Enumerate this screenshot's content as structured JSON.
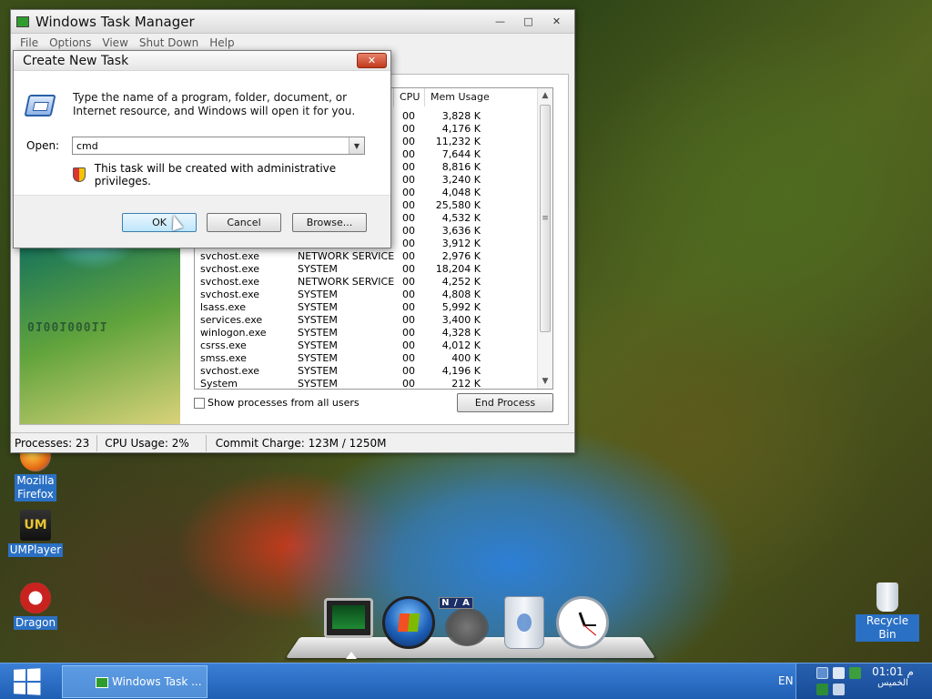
{
  "desktop": {
    "icons": [
      {
        "label_line1": "Mozilla",
        "label_line2": "Firefox"
      },
      {
        "label": "UMPlayer",
        "glyph": "UM"
      },
      {
        "label": "Dragon"
      },
      {
        "label": "Recycle Bin"
      }
    ]
  },
  "task_manager": {
    "title": "Windows Task Manager",
    "controls": {
      "minimize": "—",
      "maximize": "□",
      "close": "✕"
    },
    "menu": [
      "File",
      "Options",
      "View",
      "Shut Down",
      "Help"
    ],
    "columns": {
      "cpu": "CPU",
      "mem": "Mem Usage"
    },
    "processes_top": [
      {
        "cpu": "00",
        "mem": "3,828 K"
      },
      {
        "cpu": "00",
        "mem": "4,176 K"
      },
      {
        "cpu": "00",
        "mem": "11,232 K"
      },
      {
        "cpu": "00",
        "mem": "7,644 K"
      },
      {
        "cpu": "00",
        "mem": "8,816 K"
      },
      {
        "cpu": "00",
        "mem": "3,240 K"
      },
      {
        "cpu": "00",
        "mem": "4,048 K"
      },
      {
        "cpu": "00",
        "mem": "25,580 K"
      },
      {
        "cpu": "00",
        "mem": "4,532 K"
      },
      {
        "cpu": "00",
        "mem": "3,636 K"
      },
      {
        "cpu": "00",
        "mem": "3,912 K"
      }
    ],
    "processes": [
      {
        "name": "svchost.exe",
        "user": "NETWORK SERVICE",
        "cpu": "00",
        "mem": "2,976 K"
      },
      {
        "name": "svchost.exe",
        "user": "SYSTEM",
        "cpu": "00",
        "mem": "18,204 K"
      },
      {
        "name": "svchost.exe",
        "user": "NETWORK SERVICE",
        "cpu": "00",
        "mem": "4,252 K"
      },
      {
        "name": "svchost.exe",
        "user": "SYSTEM",
        "cpu": "00",
        "mem": "4,808 K"
      },
      {
        "name": "lsass.exe",
        "user": "SYSTEM",
        "cpu": "00",
        "mem": "5,992 K"
      },
      {
        "name": "services.exe",
        "user": "SYSTEM",
        "cpu": "00",
        "mem": "3,400 K"
      },
      {
        "name": "winlogon.exe",
        "user": "SYSTEM",
        "cpu": "00",
        "mem": "4,328 K"
      },
      {
        "name": "csrss.exe",
        "user": "SYSTEM",
        "cpu": "00",
        "mem": "4,012 K"
      },
      {
        "name": "smss.exe",
        "user": "SYSTEM",
        "cpu": "00",
        "mem": "400 K"
      },
      {
        "name": "svchost.exe",
        "user": "SYSTEM",
        "cpu": "00",
        "mem": "4,196 K"
      },
      {
        "name": "System",
        "user": "SYSTEM",
        "cpu": "00",
        "mem": "212 K"
      }
    ],
    "show_all_label": "Show processes from all users",
    "end_process_label": "End Process",
    "status": {
      "processes": "Processes: 23",
      "cpu": "CPU Usage: 2%",
      "commit": "Commit Charge: 123M / 1250M"
    }
  },
  "create_task_dialog": {
    "title": "Create New Task",
    "close": "✕",
    "description": "Type the name of a program, folder, document, or Internet resource, and Windows will open it for you.",
    "open_label": "Open:",
    "open_value": "cmd",
    "dropdown_arrow": "▼",
    "admin_note": "This task will be created with administrative privileges.",
    "ok_label": "OK",
    "cancel_label": "Cancel",
    "browse_label": "Browse..."
  },
  "dock": {
    "na_label": "N / A"
  },
  "taskbar": {
    "task_label": "Windows Task ...",
    "language": "EN",
    "clock_time": "01:01 م",
    "clock_day": "الخميس"
  },
  "colors": {
    "taskbar": "#1f5fb4",
    "dialog_close": "#c2391c",
    "icon_label_bg": "#2a70c4"
  }
}
